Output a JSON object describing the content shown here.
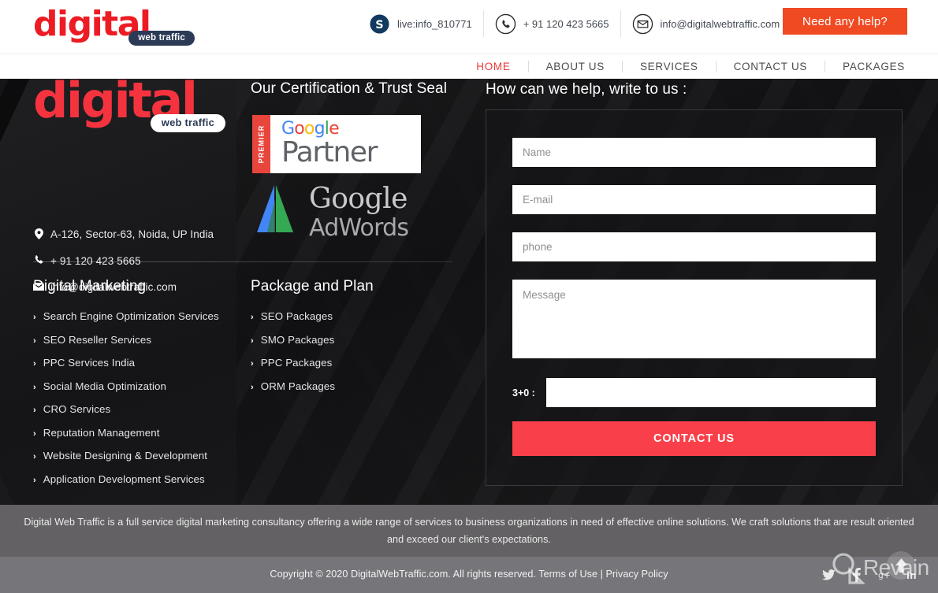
{
  "header": {
    "logo": {
      "word": "digital",
      "tag": "web traffic"
    },
    "contacts": [
      {
        "icon": "skype-icon",
        "text": "live:info_810771"
      },
      {
        "icon": "phone-icon",
        "text": "+ 91 120 423 5665"
      },
      {
        "icon": "envelope-icon",
        "text": "info@digitalwebtraffic.com"
      }
    ],
    "cta_label": "Need any help?",
    "cta_color": "#f04a23"
  },
  "nav": {
    "items": [
      {
        "label": "HOME",
        "active": true
      },
      {
        "label": "ABOUT US",
        "active": false
      },
      {
        "label": "SERVICES",
        "active": false
      },
      {
        "label": "CONTACT US",
        "active": false
      },
      {
        "label": "PACKAGES",
        "active": false
      }
    ],
    "active_color": "#ef3b3b"
  },
  "footer": {
    "logo": {
      "word": "digital",
      "tag": "web traffic"
    },
    "contact": [
      {
        "icon": "map-pin-icon",
        "glyph": "⚉",
        "text": "A-126, Sector-63, Noida, UP India"
      },
      {
        "icon": "phone-icon",
        "glyph": "☎",
        "text": "+ 91 120 423 5665"
      },
      {
        "icon": "envelope-icon",
        "glyph": "✉",
        "text": "info@digitalwebtraffic.com"
      }
    ],
    "certification": {
      "title": "Our Certification & Trust Seal",
      "google_partner": {
        "premier": "PREMIER",
        "google_letters": [
          {
            "ch": "G",
            "cls": "b1"
          },
          {
            "ch": "o",
            "cls": "r1"
          },
          {
            "ch": "o",
            "cls": "y1"
          },
          {
            "ch": "g",
            "cls": "b1"
          },
          {
            "ch": "l",
            "cls": "g1"
          },
          {
            "ch": "e",
            "cls": "r1"
          }
        ],
        "partner": "Partner"
      },
      "adwords": {
        "line1": "Google",
        "line2": "AdWords"
      }
    },
    "columns": [
      {
        "title": "Digital Marketing",
        "links": [
          "Search Engine Optimization Services",
          "SEO Reseller Services",
          "PPC Services India",
          "Social Media Optimization",
          "CRO Services",
          "Reputation Management",
          "Website Designing & Development",
          "Application Development Services"
        ]
      },
      {
        "title": "Package and Plan",
        "links": [
          "SEO Packages",
          "SMO Packages",
          "PPC Packages",
          "ORM Packages"
        ]
      }
    ],
    "form": {
      "title": "How can we help, write to us :",
      "name_placeholder": "Name",
      "email_placeholder": "E-mail",
      "phone_placeholder": "phone",
      "message_placeholder": "Message",
      "name_value": "",
      "email_value": "",
      "phone_value": "",
      "message_value": "",
      "captcha_label": "3+0 :",
      "captcha_value": "",
      "submit_label": "CONTACT US",
      "submit_color": "#f9404a"
    },
    "description": "Digital Web Traffic is a full service digital marketing consultancy offering a wide range of services to business organizations in need of effective online solutions. We craft solutions that are result oriented and exceed our client's expectations.",
    "copyright": {
      "prefix": "Copyright © 2020 DigitalWebTraffic.com. All rights reserved. ",
      "terms": "Terms of Use",
      "separator": " | ",
      "privacy": "Privacy Policy"
    },
    "social": [
      {
        "icon": "twitter-icon",
        "glyph": "🐦"
      },
      {
        "icon": "facebook-icon",
        "glyph": "f"
      },
      {
        "icon": "google-plus-icon",
        "glyph": "g+"
      },
      {
        "icon": "linkedin-icon",
        "glyph": "in"
      }
    ],
    "watermark": "Revain",
    "scroll_top_icon": "arrow-up-icon"
  }
}
